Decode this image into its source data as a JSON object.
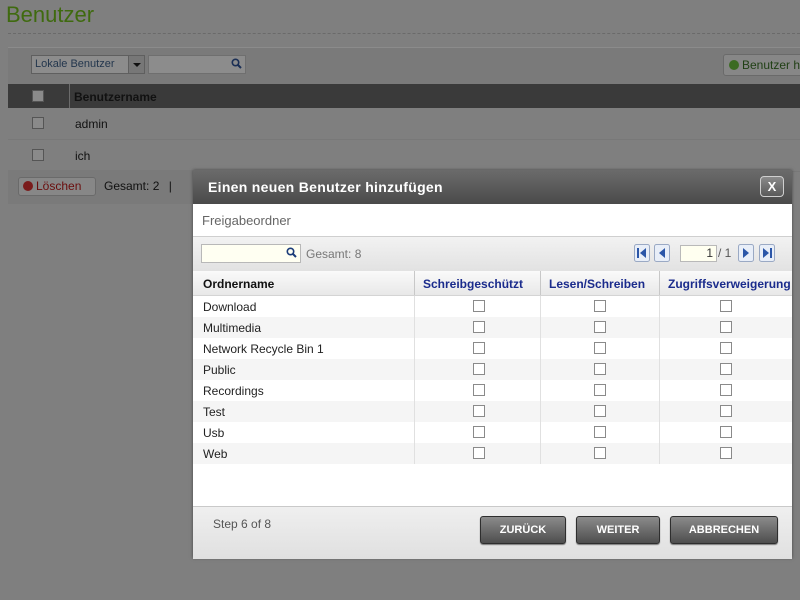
{
  "page": {
    "title": "Benutzer",
    "user_type_select": "Lokale Benutzer",
    "add_user_label": "Benutzer h",
    "user_table": {
      "col_username": "Benutzername",
      "rows": [
        "admin",
        "ich"
      ]
    },
    "delete_label": "Löschen",
    "total_label": "Gesamt:",
    "total_value": "2",
    "total_sep": "|"
  },
  "modal": {
    "title": "Einen neuen Benutzer hinzufügen",
    "close_label": "X",
    "section_title": "Freigabeordner",
    "total_label": "Gesamt:",
    "total_value": "8",
    "page_current": "1",
    "page_of": "/ 1",
    "columns": [
      "Ordnername",
      "Schreibgeschützt",
      "Lesen/Schreiben",
      "Zugriffsverweigerung"
    ],
    "folders": [
      "Download",
      "Multimedia",
      "Network Recycle Bin 1",
      "Public",
      "Recordings",
      "Test",
      "Usb",
      "Web"
    ],
    "step": "Step 6 of 8",
    "buttons": {
      "back": "ZURÜCK",
      "next": "WEITER",
      "cancel": "ABBRECHEN"
    }
  },
  "colors": {
    "title_green": "#3f6a0f",
    "header_blue": "#1a2b8c",
    "overlay": "#7f7f7f"
  }
}
